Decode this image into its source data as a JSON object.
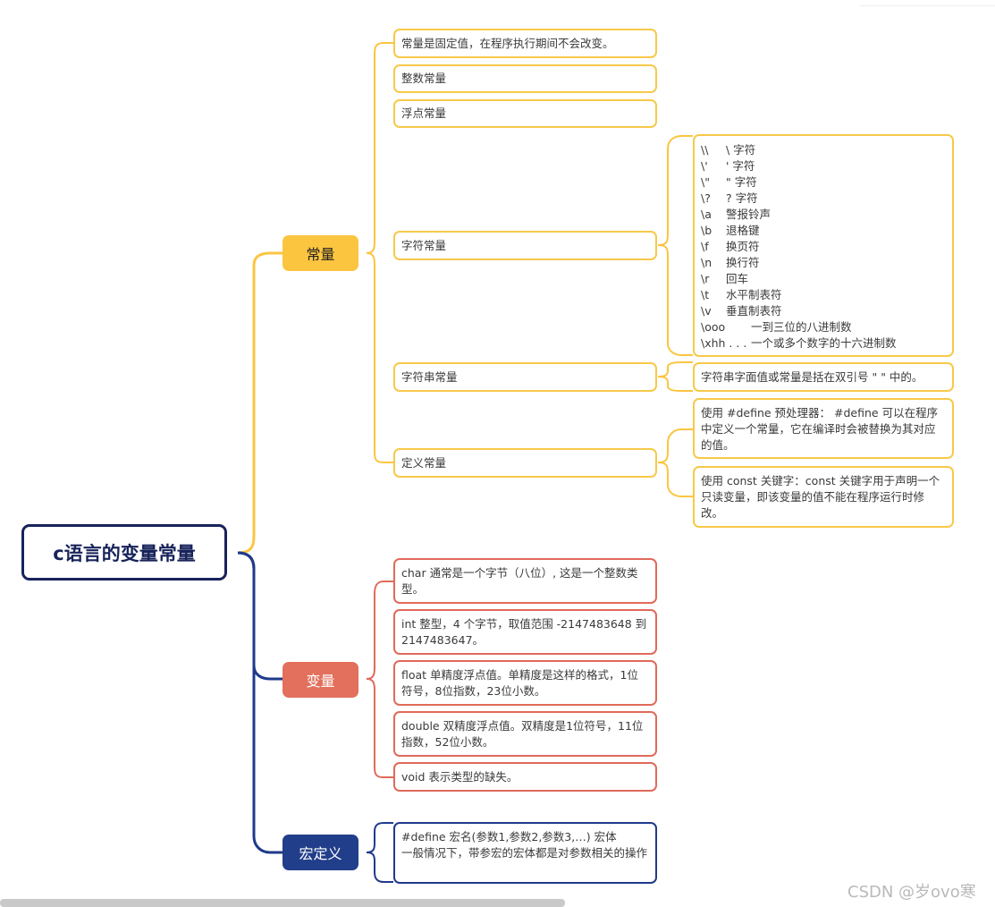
{
  "colors": {
    "root_border": "#17235a",
    "constants": "#fcc540",
    "variables": "#e2705c",
    "macro": "#213e8a"
  },
  "root": {
    "label": "c语言的变量常量"
  },
  "constants": {
    "label": "常量",
    "items": [
      {
        "text": "常量是固定值，在程序执行期间不会改变。"
      },
      {
        "text": "整数常量"
      },
      {
        "text": "浮点常量"
      },
      {
        "text": "字符常量"
      },
      {
        "text": "字符串常量"
      },
      {
        "text": "定义常量"
      }
    ],
    "escape_sequences": [
      {
        "code": "\\\\",
        "desc": "\\ 字符"
      },
      {
        "code": "\\'",
        "desc": "' 字符"
      },
      {
        "code": "\\\"",
        "desc": "\" 字符"
      },
      {
        "code": "\\?",
        "desc": "? 字符"
      },
      {
        "code": "\\a",
        "desc": "警报铃声"
      },
      {
        "code": "\\b",
        "desc": "退格键"
      },
      {
        "code": "\\f",
        "desc": "换页符"
      },
      {
        "code": "\\n",
        "desc": "换行符"
      },
      {
        "code": "\\r",
        "desc": "回车"
      },
      {
        "code": "\\t",
        "desc": "水平制表符"
      },
      {
        "code": "\\v",
        "desc": "垂直制表符"
      },
      {
        "code": "\\ooo",
        "desc": "一到三位的八进制数"
      },
      {
        "code": "\\xhh . . .",
        "desc": "一个或多个数字的十六进制数"
      }
    ],
    "string_note": "字符串字面值或常量是括在双引号 \" \" 中的。",
    "define_notes": [
      "使用 #define 预处理器： #define 可以在程序中定义一个常量，它在编译时会被替换为其对应的值。",
      "使用 const 关键字：const 关键字用于声明一个只读变量，即该变量的值不能在程序运行时修改。"
    ]
  },
  "variables": {
    "label": "变量",
    "items": [
      {
        "text": "char      通常是一个字节（八位）, 这是一个整数类型。"
      },
      {
        "text": "int   整型，4 个字节，取值范围 -2147483648 到 2147483647。"
      },
      {
        "text": "float      单精度浮点值。单精度是这样的格式，1位符号，8位指数，23位小数。"
      },
      {
        "text": "double  双精度浮点值。双精度是1位符号，11位指数，52位小数。"
      },
      {
        "text": "void       表示类型的缺失。"
      }
    ]
  },
  "macro": {
    "label": "宏定义",
    "line1": "#define 宏名(参数1,参数2,参数3,…) 宏体",
    "line2": "一般情况下，带参宏的宏体都是对参数相关的操作"
  },
  "watermark": "CSDN @岁ovo寒"
}
